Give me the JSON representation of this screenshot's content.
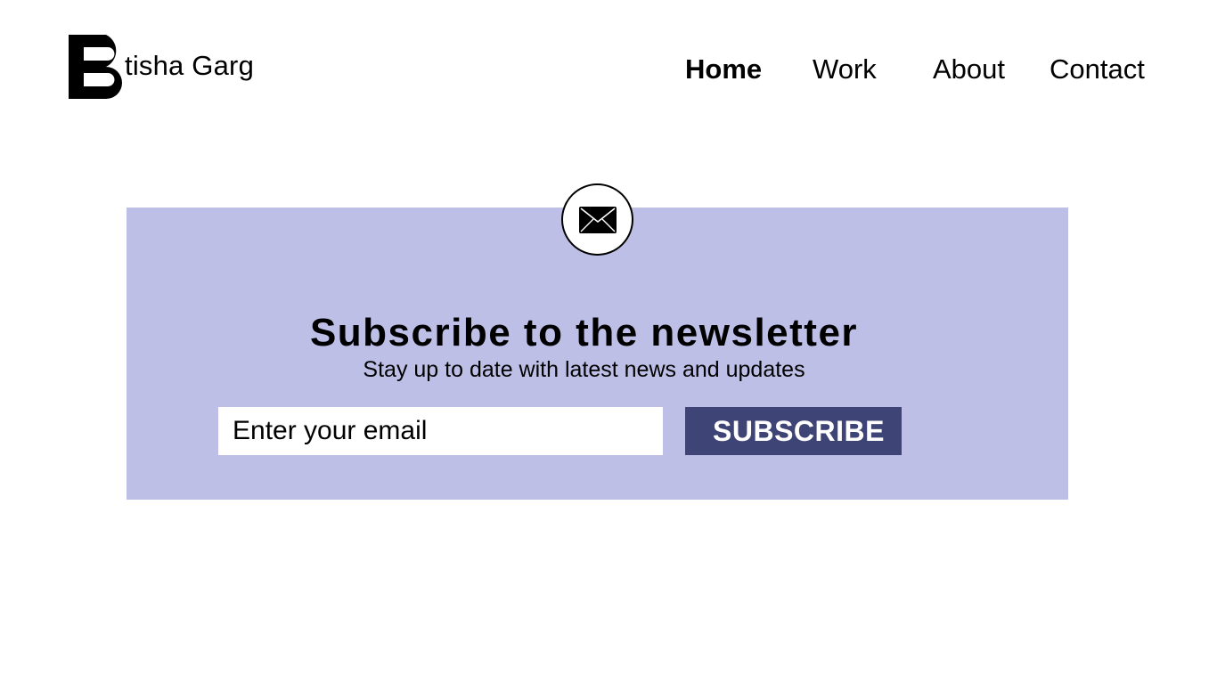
{
  "header": {
    "logo_text": "tisha Garg",
    "nav": {
      "home": "Home",
      "work": "Work",
      "about": "About",
      "contact": "Contact"
    },
    "active_nav": "Home"
  },
  "newsletter": {
    "icon": "envelope-icon",
    "title": "Subscribe to the newsletter",
    "subtitle": "Stay up to date with latest news and updates",
    "email_placeholder": "Enter your email",
    "email_value": "",
    "button_label": "SUBSCRIBE"
  },
  "colors": {
    "panel_background": "#bdbfe7",
    "button_background": "#3f4476",
    "button_text": "#ffffff",
    "text": "#000000"
  }
}
